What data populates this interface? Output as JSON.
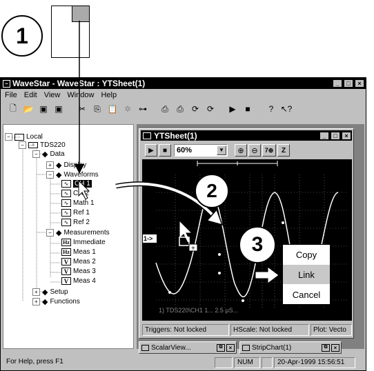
{
  "callouts": {
    "step1": "1",
    "step2": "2",
    "step3": "3"
  },
  "app": {
    "title": "WaveStar - WaveStar : YTSheet(1)"
  },
  "menu": {
    "file": "File",
    "edit": "Edit",
    "view": "View",
    "window": "Window",
    "help": "Help"
  },
  "tree": {
    "local": "Local",
    "device": "TDS220",
    "data": "Data",
    "display": "Display",
    "waveforms": "Waveforms",
    "ch1": "CH 1",
    "ch2": "CH 2",
    "math1": "Math 1",
    "ref1": "Ref 1",
    "ref2": "Ref 2",
    "measurements": "Measurements",
    "immediate": "Immediate",
    "meas1": "Meas 1",
    "meas2": "Meas 2",
    "meas3": "Meas 3",
    "meas4": "Meas 4",
    "setup": "Setup",
    "functions": "Functions"
  },
  "ytsheet": {
    "title": "YTSheet(1)",
    "zoom": "60%",
    "readout": "1) TDS220\\CH1  1...   2.5 µS...",
    "ch_marker": "1->",
    "trigger_marker": "T",
    "status_triggers": "Triggers: Not locked",
    "status_hscale": "HScale: Not locked",
    "status_plot": "Plot: Vecto"
  },
  "context_menu": {
    "copy": "Copy",
    "link": "Link",
    "cancel": "Cancel"
  },
  "taskbar": {
    "scalar": "ScalarView...",
    "strip": "StripChart(1)"
  },
  "statusbar": {
    "help": "For Help, press F1",
    "num": "NUM",
    "datetime": "20-Apr-1999 15:56:51"
  }
}
